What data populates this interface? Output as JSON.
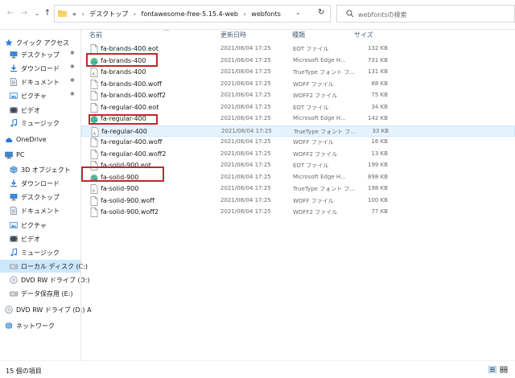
{
  "address": {
    "back_icon": "arrow-left-icon",
    "forward_icon": "arrow-right-icon",
    "recent_icon": "chevron-down-icon",
    "up_icon": "arrow-up-icon",
    "overflow": "«",
    "crumbs": [
      "デスクトップ",
      "fontawesome-free-5.15.4-web",
      "webfonts"
    ],
    "sep": "›",
    "search_placeholder": "webfontsの検索"
  },
  "sidebar": {
    "items": [
      {
        "label": "クイック アクセス",
        "icon": "star-icon"
      },
      {
        "label": "デスクトップ",
        "icon": "desktop-icon",
        "pinned": true
      },
      {
        "label": "ダウンロード",
        "icon": "download-icon",
        "pinned": true
      },
      {
        "label": "ドキュメント",
        "icon": "document-icon",
        "pinned": true
      },
      {
        "label": "ピクチャ",
        "icon": "picture-icon",
        "pinned": true
      },
      {
        "label": "ビデオ",
        "icon": "video-icon"
      },
      {
        "label": "ミュージック",
        "icon": "music-icon"
      },
      {
        "label": "OneDrive",
        "icon": "cloud-icon"
      },
      {
        "label": "PC",
        "icon": "pc-icon"
      },
      {
        "label": "3D オブジェクト",
        "icon": "cube-icon"
      },
      {
        "label": "ダウンロード",
        "icon": "download-icon"
      },
      {
        "label": "デスクトップ",
        "icon": "desktop-icon"
      },
      {
        "label": "ドキュメント",
        "icon": "document-icon"
      },
      {
        "label": "ピクチャ",
        "icon": "picture-icon"
      },
      {
        "label": "ビデオ",
        "icon": "video-icon"
      },
      {
        "label": "ミュージック",
        "icon": "music-icon"
      },
      {
        "label": "ローカル ディスク (C:)",
        "icon": "drive-icon",
        "selected": true
      },
      {
        "label": "DVD RW ドライブ (D:)",
        "icon": "dvd-icon"
      },
      {
        "label": "データ保存用 (E:)",
        "icon": "drive-icon"
      },
      {
        "label": "DVD RW ドライブ (D:) A",
        "icon": "dvd-icon"
      },
      {
        "label": "ネットワーク",
        "icon": "network-icon"
      }
    ],
    "pin_glyph": "✱"
  },
  "columns": {
    "name": "名前",
    "date": "更新日時",
    "type": "種類",
    "size": "サイズ"
  },
  "files": [
    {
      "name": "fa-brands-400.eot",
      "date": "2021/08/04 17:25",
      "type": "EOT ファイル",
      "size": "132 KB",
      "icon": "file-icon"
    },
    {
      "name": "fa-brands-400",
      "date": "2021/08/04 17:25",
      "type": "Microsoft Edge H...",
      "size": "731 KB",
      "icon": "edge-icon"
    },
    {
      "name": "fa-brands-400",
      "date": "2021/08/04 17:25",
      "type": "TrueType フォント フ...",
      "size": "131 KB",
      "icon": "font-icon"
    },
    {
      "name": "fa-brands-400.woff",
      "date": "2021/08/04 17:25",
      "type": "WOFF ファイル",
      "size": "88 KB",
      "icon": "file-icon"
    },
    {
      "name": "fa-brands-400.woff2",
      "date": "2021/08/04 17:25",
      "type": "WOFF2 ファイル",
      "size": "75 KB",
      "icon": "file-icon"
    },
    {
      "name": "fa-regular-400.eot",
      "date": "2021/08/04 17:25",
      "type": "EOT ファイル",
      "size": "34 KB",
      "icon": "file-icon"
    },
    {
      "name": "fa-regular-400",
      "date": "2021/08/04 17:25",
      "type": "Microsoft Edge H...",
      "size": "142 KB",
      "icon": "edge-icon"
    },
    {
      "name": "fa-regular-400",
      "date": "2021/08/04 17:25",
      "type": "TrueType フォント フ...",
      "size": "33 KB",
      "icon": "font-icon"
    },
    {
      "name": "fa-regular-400.woff",
      "date": "2021/08/04 17:25",
      "type": "WOFF ファイル",
      "size": "16 KB",
      "icon": "file-icon"
    },
    {
      "name": "fa-regular-400.woff2",
      "date": "2021/08/04 17:25",
      "type": "WOFF2 ファイル",
      "size": "13 KB",
      "icon": "file-icon"
    },
    {
      "name": "fa-solid-900.eot",
      "date": "2021/08/04 17:25",
      "type": "EOT ファイル",
      "size": "199 KB",
      "icon": "file-icon"
    },
    {
      "name": "fa-solid-900",
      "date": "2021/08/04 17:25",
      "type": "Microsoft Edge H...",
      "size": "898 KB",
      "icon": "edge-icon"
    },
    {
      "name": "fa-solid-900",
      "date": "2021/08/04 17:25",
      "type": "TrueType フォント フ...",
      "size": "198 KB",
      "icon": "font-icon"
    },
    {
      "name": "fa-solid-900.woff",
      "date": "2021/08/04 17:25",
      "type": "WOFF ファイル",
      "size": "100 KB",
      "icon": "file-icon"
    },
    {
      "name": "fa-solid-900.woff2",
      "date": "2021/08/04 17:25",
      "type": "WOFF2 ファイル",
      "size": "77 KB",
      "icon": "file-icon"
    }
  ],
  "status": {
    "item_count": "15 個の項目"
  },
  "colors": {
    "highlight_box": "#c0282d",
    "selected_sidebar": "#cce8ff",
    "hover_row": "#e5f3ff",
    "header_text": "#4c607a"
  }
}
